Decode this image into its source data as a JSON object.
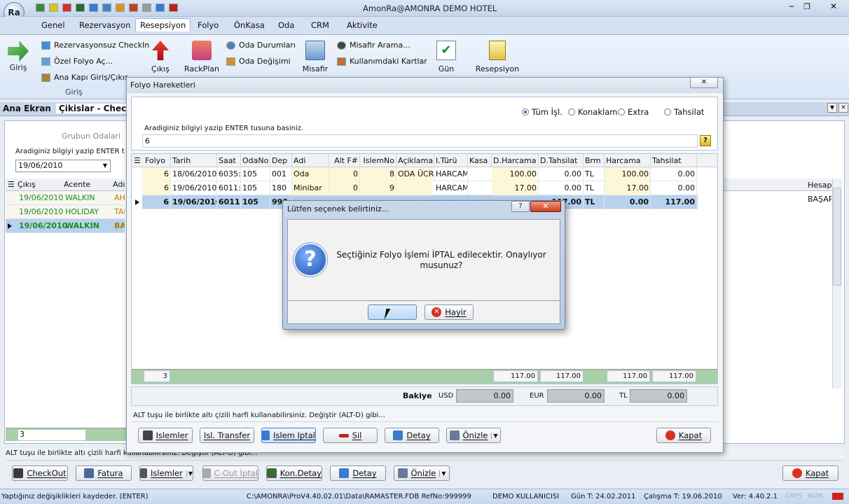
{
  "app": {
    "title": "AmonRa@AMONRA DEMO HOTEL"
  },
  "ribbon": {
    "tabs": [
      "Genel",
      "Rezervasyon",
      "Resepsiyon",
      "Folyo",
      "ÖnKasa",
      "Oda",
      "CRM",
      "Aktivite"
    ],
    "giris": "Giriş",
    "group_label": "Giriş",
    "rez_checkin": "Rezervasyonsuz CheckIn",
    "ozel_folyo": "Özel Folyo Aç...",
    "ana_kapi": "Ana Kapı Giriş/Çıkış",
    "cikis": "Çıkış",
    "rackplan": "RackPlan",
    "oda_durumlari": "Oda Durumları",
    "oda_degisimi": "Oda Değişimi",
    "misafir": "Misafir",
    "misafir_arama": "Misafir Arama...",
    "kullanim_kartlar": "Kullanımdaki Kartlar",
    "gun": "Gün",
    "resepsiyon": "Resepsiyon"
  },
  "bg": {
    "tabs": [
      "Ana Ekran",
      "Çikislar - CheckO"
    ],
    "grubun_odalari": "Grubun Odalari",
    "hint": "Aradiginiz bilgiyi yazip ENTER tusun",
    "date": "19/06/2010",
    "columns": [
      "Çıkış",
      "Acente",
      "Adı"
    ],
    "rows": [
      [
        "19/06/2010",
        "WALKIN",
        "AHN"
      ],
      [
        "19/06/2010",
        "HOLIDAY",
        "TAN"
      ],
      [
        "19/06/2010",
        "WALKIN",
        "BAI"
      ]
    ],
    "right_header": "Hesap",
    "right_value": "BAŞAR",
    "count": "3",
    "hint_bar": "ALT tuşu ile birlikte altı çizili harfi kullanabilirsiniz. Değiştir (ALT-D) gibi...",
    "buttons": [
      "CheckOut",
      "Fatura",
      "Islemler",
      "C-Out İptal",
      "Kon.Detay",
      "Detay",
      "Önizle",
      "Kapat"
    ]
  },
  "folyo": {
    "title": "Folyo Hareketleri",
    "radios": [
      "Tüm İşl.",
      "Konaklam",
      "Extra",
      "Tahsilat"
    ],
    "hint": "Aradiginiz bilgiyi yazip ENTER tusuna basiniz.",
    "search_value": "6",
    "columns": [
      "Folyo",
      "Tarih",
      "Saat",
      "OdaNo",
      "Dep",
      "Adi",
      "Alt F#",
      "IslemNo",
      "Açiklama",
      "I.Türü",
      "Kasa",
      "D.Harcama",
      "D.Tahsilat",
      "Brm",
      "Harcama",
      "Tahsilat"
    ],
    "rows": [
      [
        "6",
        "18/06/2010",
        "6035:",
        "105",
        "001",
        "Oda",
        "0",
        "8",
        "ODA ÜCR",
        "HARCAM",
        "",
        "100.00",
        "0.00",
        "TL",
        "100.00",
        "0.00"
      ],
      [
        "6",
        "19/06/2010",
        "6011:",
        "105",
        "180",
        "Minibar",
        "0",
        "9",
        "",
        "HARCAM",
        "",
        "17.00",
        "0.00",
        "TL",
        "17.00",
        "0.00"
      ],
      [
        "6",
        "19/06/2010",
        "6011:",
        "105",
        "990",
        "",
        "",
        "",
        "",
        "",
        "",
        "",
        "117.00",
        "TL",
        "0.00",
        "117.00"
      ]
    ],
    "footer": {
      "count": "3",
      "d_harcama": "117.00",
      "d_tahsilat": "117.00",
      "harcama": "117.00",
      "tahsilat": "117.00"
    },
    "bakiye": {
      "label": "Bakiye",
      "usd_label": "USD",
      "usd": "0.00",
      "eur_label": "EUR",
      "eur": "0.00",
      "tl_label": "TL",
      "tl": "0.00"
    },
    "hint_bar": "ALT tuşu ile birlikte altı çizili harfi kullanabilirsiniz. Değiştir (ALT-D) gibi...",
    "buttons": [
      "Islemler",
      "Isl. Transfer",
      "Islem Iptal",
      "Sil",
      "Detay",
      "Önizle",
      "Kapat"
    ]
  },
  "dialog": {
    "title": "Lütfen seçenek belirtiniz...",
    "message": "Seçtiğiniz Folyo İşlemi İPTAL edilecektir. Onaylıyor musunuz?",
    "yes": "",
    "no": "Hayir",
    "help": "?"
  },
  "status": {
    "message": "Yaptığınız değişiklikleri kaydeder. (ENTER)",
    "path": "C:\\AMONRA\\ProV4.40.02.01\\Data\\RAMASTER.FDB RefNo:999999",
    "user": "DEMO KULLANICISI",
    "gun": "Gün T: 24.02.2011",
    "calisma": "Çalışma T: 19.06.2010",
    "ver": "Ver: 4.40.2.1",
    "caps": "CAPS",
    "num": "NUM"
  }
}
